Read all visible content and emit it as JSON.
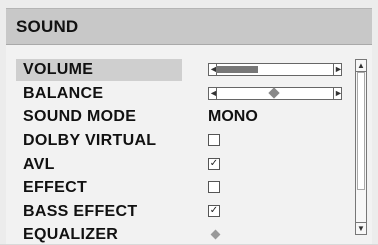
{
  "window": {
    "title": "SOUND"
  },
  "menu": {
    "items": [
      {
        "id": "volume",
        "label": "VOLUME",
        "type": "slider",
        "level": 0.36
      },
      {
        "id": "balance",
        "label": "BALANCE",
        "type": "slider-center",
        "level": 0.5
      },
      {
        "id": "sound_mode",
        "label": "SOUND MODE",
        "type": "value",
        "value": "MONO"
      },
      {
        "id": "dolby_virtual",
        "label": "DOLBY VIRTUAL",
        "type": "checkbox",
        "checked": false
      },
      {
        "id": "avl",
        "label": "AVL",
        "type": "checkbox",
        "checked": true
      },
      {
        "id": "effect",
        "label": "EFFECT",
        "type": "checkbox",
        "checked": false
      },
      {
        "id": "bass_effect",
        "label": "BASS EFFECT",
        "type": "checkbox",
        "checked": true
      },
      {
        "id": "equalizer",
        "label": "EQUALIZER",
        "type": "submenu"
      }
    ],
    "check_mark": "✓"
  },
  "icons": {
    "left_cap": "◄",
    "right_cap": "►",
    "scroll_up": "▲",
    "scroll_down": "▼"
  },
  "colors": {
    "header": "#c8c8c8",
    "highlight": "#cfcfcf",
    "slider_fill": "#777777"
  }
}
